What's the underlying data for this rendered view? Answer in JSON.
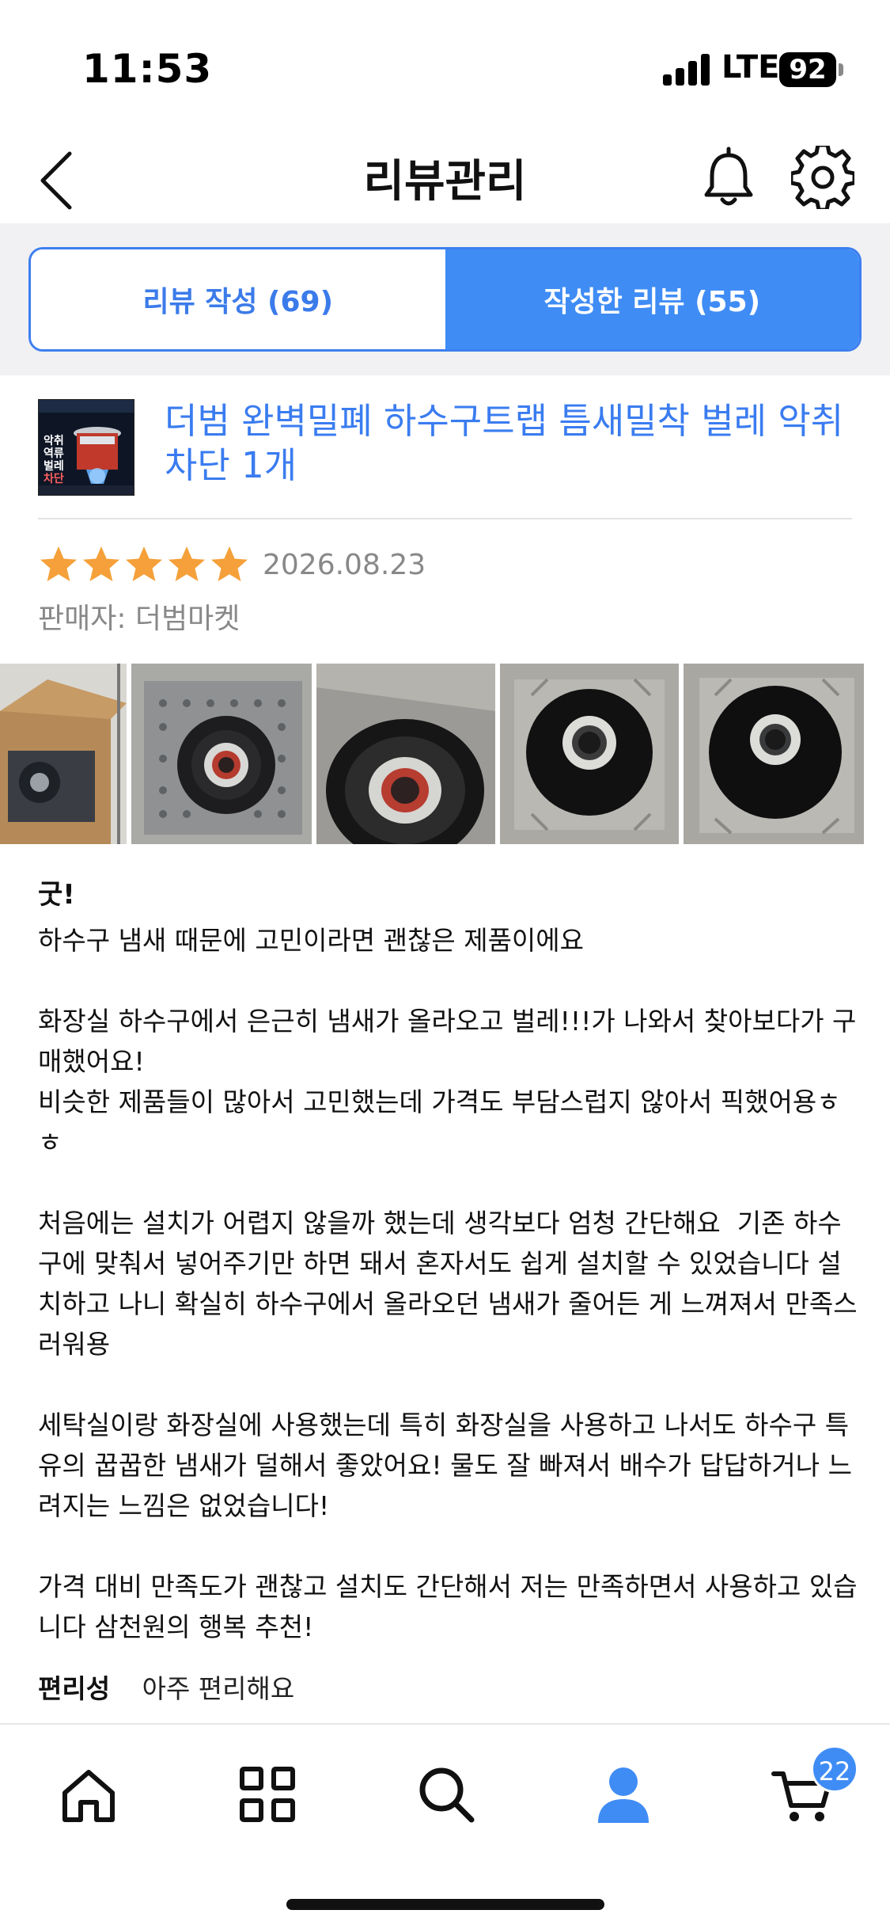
{
  "status_bar": {
    "time": "11:53",
    "network": "LTE",
    "battery": "92"
  },
  "header": {
    "title": "리뷰관리"
  },
  "tabs": [
    {
      "label": "리뷰 작성 (69)",
      "active": false
    },
    {
      "label": "작성한 리뷰 (55)",
      "active": true
    }
  ],
  "product": {
    "name": "더범 완벽밀폐 하수구트랩 틈새밀착 벌레 악취차단 1개",
    "thumb_text": [
      "악취",
      "역류",
      "벌레",
      "차단"
    ]
  },
  "review": {
    "rating": 5,
    "date": "2026.08.23",
    "seller": "판매자: 더범마켓",
    "title": "굿!",
    "body": "하수구 냄새 때문에 고민이라면 괜찮은 제품이에요\n\n화장실 하수구에서 은근히 냄새가 올라오고 벌레!!!가 나와서 찾아보다가 구매했어요!\n비슷한 제품들이 많아서 고민했는데 가격도 부담스럽지 않아서 픽했어용ㅎㅎ\n\n처음에는 설치가 어렵지 않을까 했는데 생각보다 엄청 간단해요  기존 하수구에 맞춰서 넣어주기만 하면 돼서 혼자서도 쉽게 설치할 수 있었습니다 설치하고 나니 확실히 하수구에서 올라오던 냄새가 줄어든 게 느껴져서 만족스러워용\n\n세탁실이랑 화장실에 사용했는데 특히 화장실을 사용하고 나서도 하수구 특유의 꿉꿉한 냄새가 덜해서 좋았어요! 물도 잘 빠져서 배수가 답답하거나 느려지는 느낌은 없었습니다!\n\n가격 대비 만족도가 괜찮고 설치도 간단해서 저는 만족하면서 사용하고 있습니다 삼천원의 행복 추천!",
    "attribute_label": "편리성",
    "attribute_value": "아주 편리해요"
  },
  "nav": {
    "items": [
      "home-icon",
      "grid-icon",
      "search-icon",
      "profile-icon",
      "cart-icon"
    ],
    "cart_count": "22"
  },
  "colors": {
    "accent": "#3f8cf5",
    "star": "#f5a03a"
  }
}
